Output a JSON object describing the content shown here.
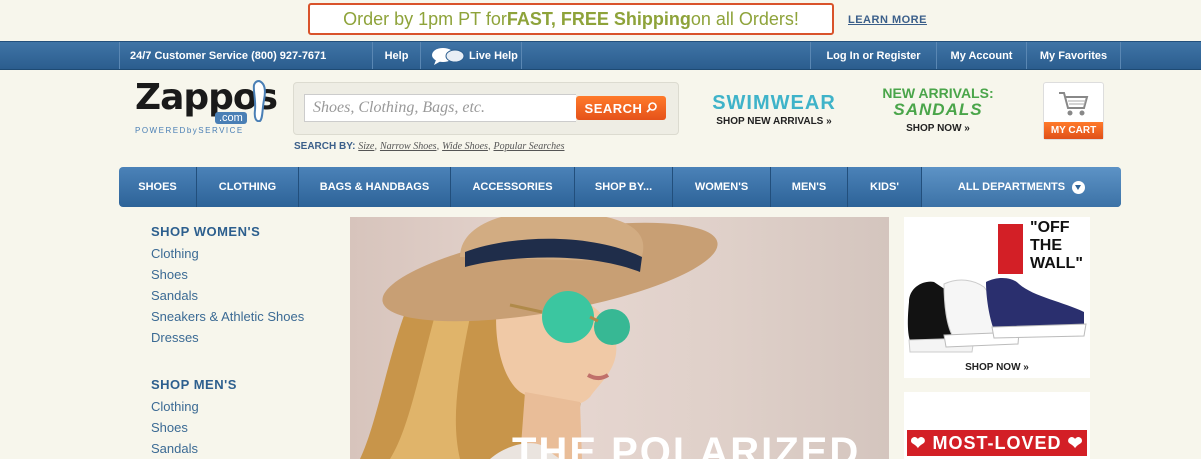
{
  "promo_bar": {
    "text_prefix": "Order by 1pm PT for ",
    "text_bold": "FAST, FREE Shipping",
    "text_suffix": " on all Orders!",
    "learn_more": "LEARN MORE"
  },
  "util_bar": {
    "customer_service": "24/7 Customer Service (800) 927-7671",
    "help": "Help",
    "live_help": "Live Help",
    "login": "Log In or Register",
    "account": "My Account",
    "favorites": "My Favorites"
  },
  "logo": {
    "name": "Zappos",
    "domain": ".com",
    "tagline": "POWEREDbySERVICE"
  },
  "search": {
    "placeholder": "Shoes, Clothing, Bags, etc.",
    "button": "SEARCH",
    "search_by_label": "SEARCH BY:",
    "links": [
      "Size",
      "Narrow Shoes",
      "Wide Shoes",
      "Popular Searches"
    ]
  },
  "header_promos": {
    "swimwear_title": "SWIMWEAR",
    "swimwear_sub": "SHOP NEW ARRIVALS »",
    "sandals_line1": "NEW ARRIVALS:",
    "sandals_line2": "SANDALS",
    "sandals_sub": "SHOP NOW »"
  },
  "cart": {
    "label": "MY CART"
  },
  "main_nav": [
    "SHOES",
    "CLOTHING",
    "BAGS & HANDBAGS",
    "ACCESSORIES",
    "SHOP BY...",
    "WOMEN'S",
    "MEN'S",
    "KIDS'",
    "ALL DEPARTMENTS"
  ],
  "sidebar": {
    "women_heading": "SHOP WOMEN'S",
    "women_links": [
      "Clothing",
      "Shoes",
      "Sandals",
      "Sneakers & Athletic Shoes",
      "Dresses"
    ],
    "men_heading": "SHOP MEN'S",
    "men_links": [
      "Clothing",
      "Shoes",
      "Sandals"
    ]
  },
  "hero": {
    "headline": "THE POLARIZED"
  },
  "right_promos": {
    "vans_logo": "VANS",
    "vans_text_line1": "\"OFF",
    "vans_text_line2": "THE",
    "vans_text_line3": "WALL\"",
    "vans_cta": "SHOP NOW »",
    "loved_banner": "❤ MOST-LOVED ❤"
  },
  "colors": {
    "nav_blue": "#2d6398",
    "accent_orange": "#e5521a",
    "promo_green": "#8ea33a",
    "link_blue": "#3b6a94",
    "brand_red": "#d31f26"
  }
}
